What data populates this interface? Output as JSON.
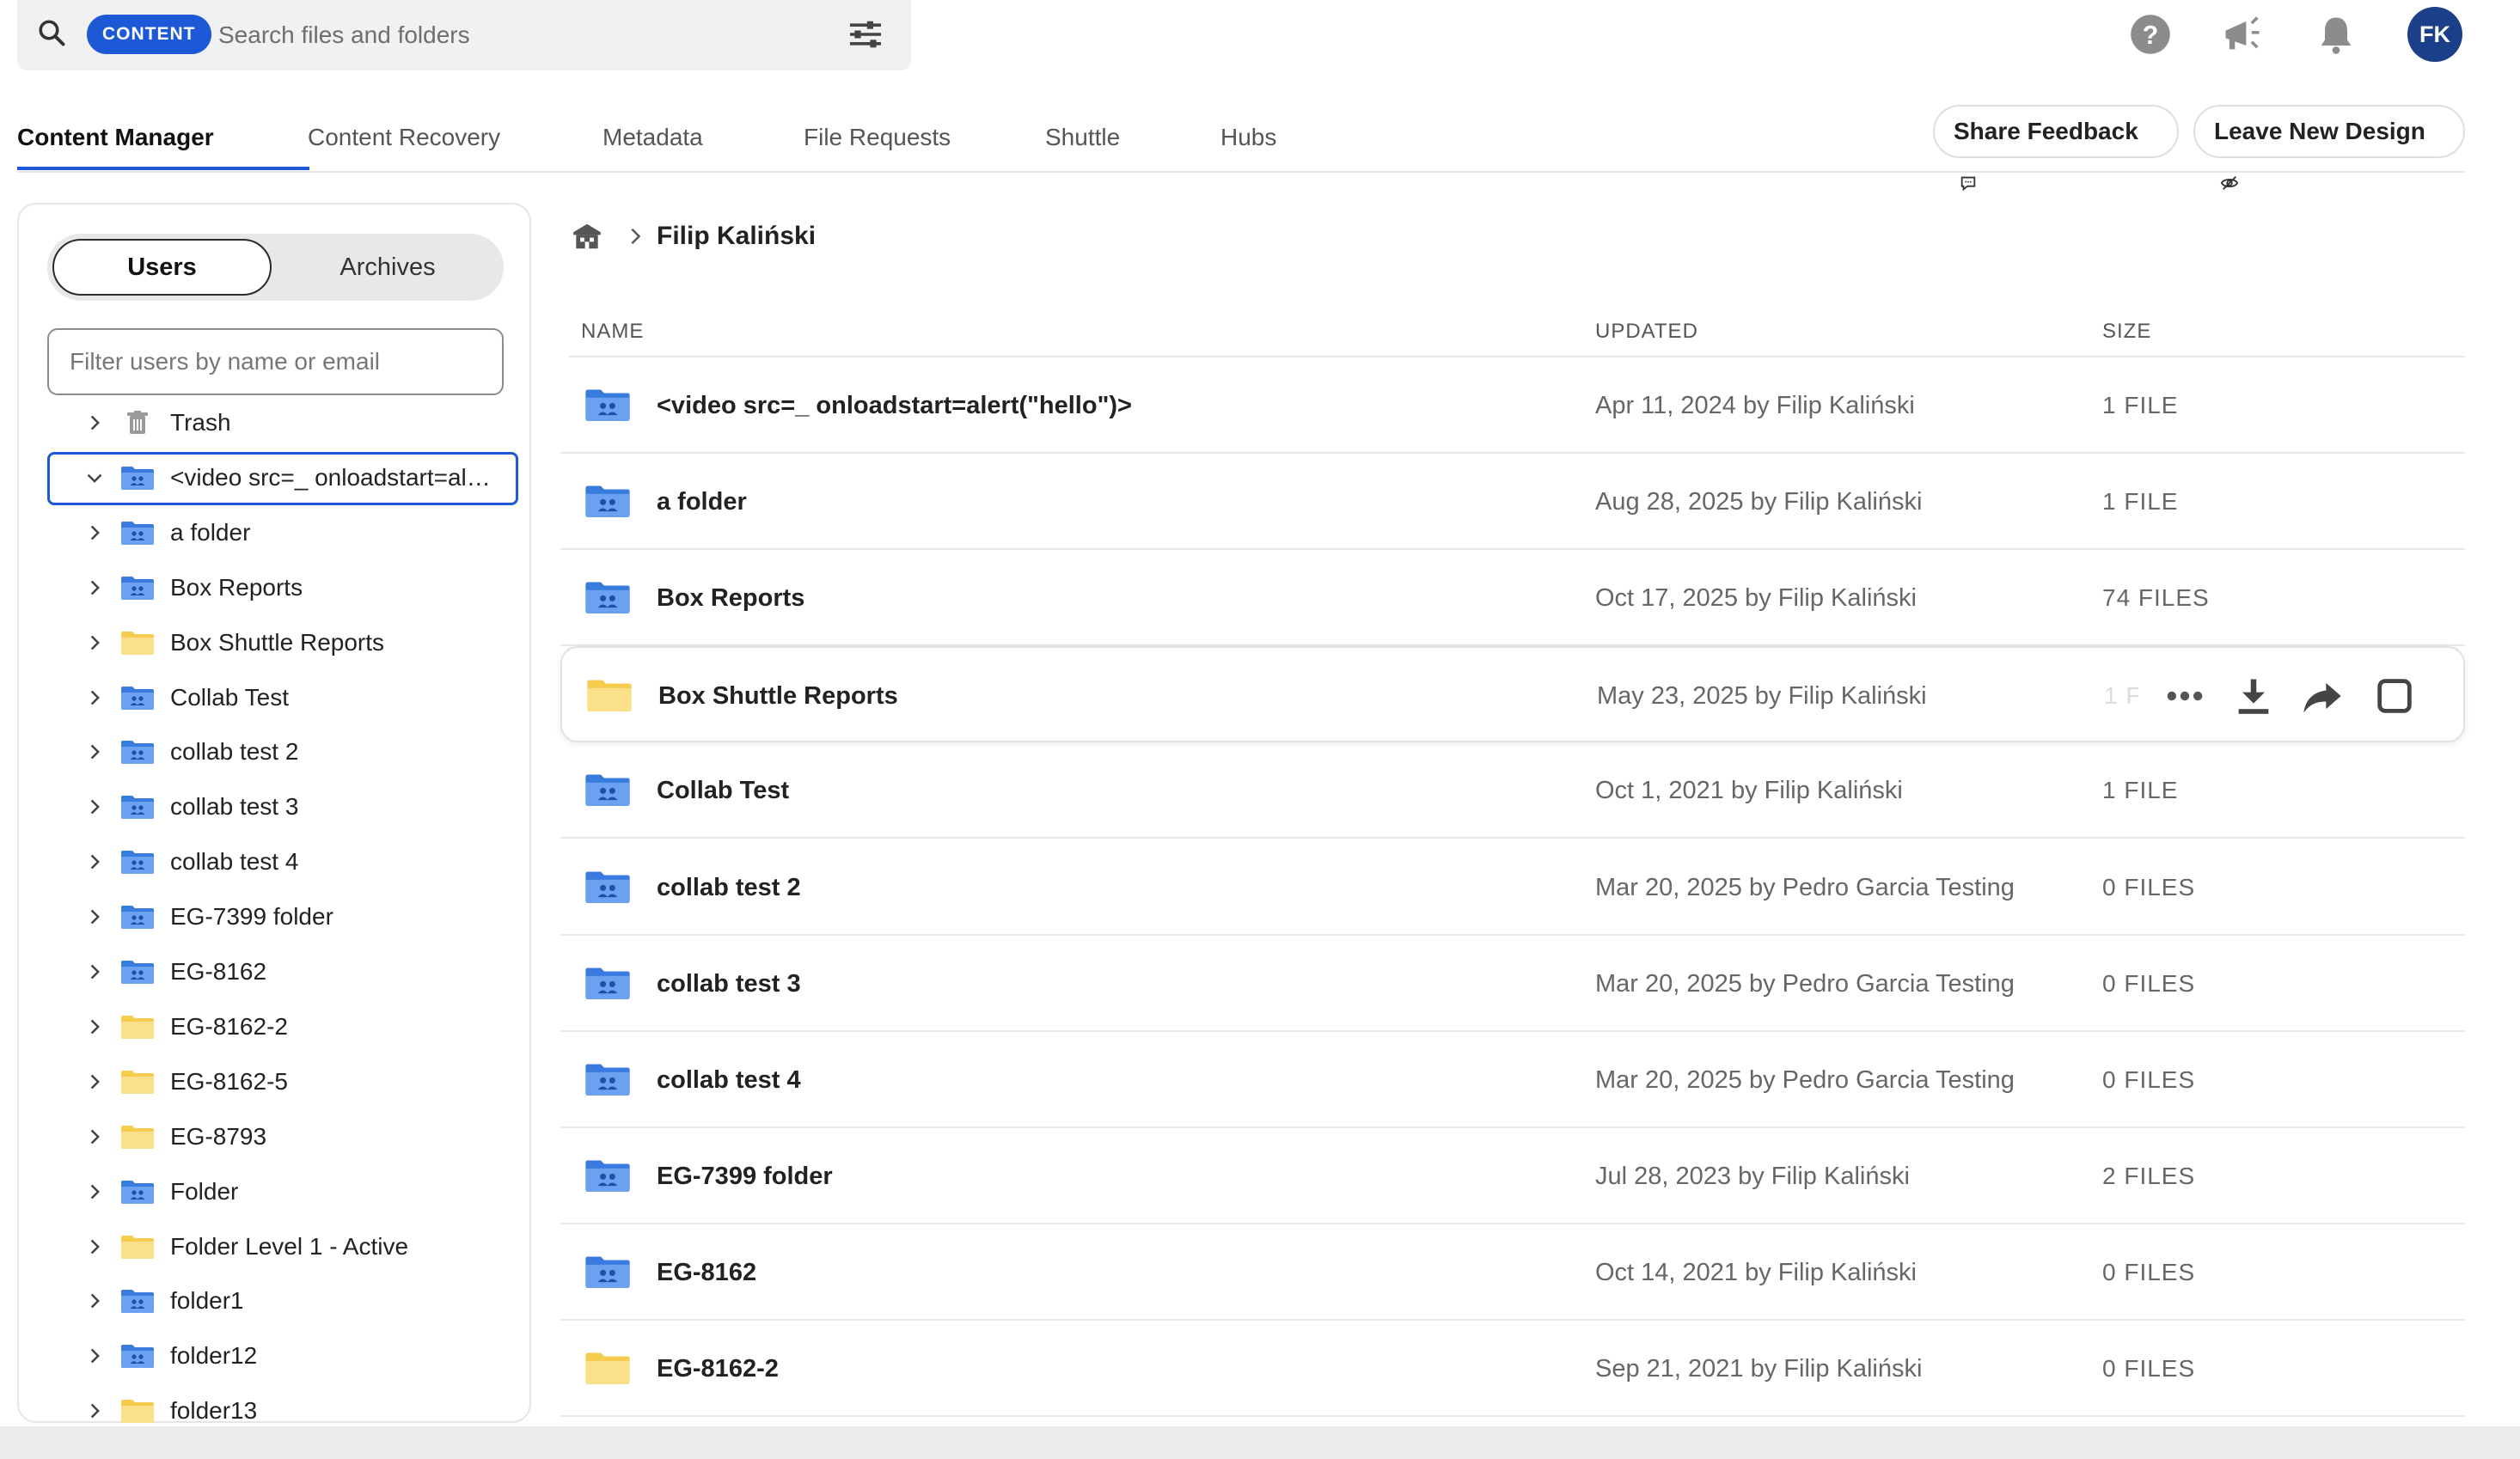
{
  "search": {
    "scope_label": "CONTENT",
    "placeholder": "Search files and folders"
  },
  "user": {
    "initials": "FK"
  },
  "tabs": [
    {
      "label": "Content Manager",
      "active": true
    },
    {
      "label": "Content Recovery"
    },
    {
      "label": "Metadata"
    },
    {
      "label": "File Requests"
    },
    {
      "label": "Shuttle"
    },
    {
      "label": "Hubs"
    }
  ],
  "header_buttons": {
    "share_feedback": "Share Feedback",
    "leave_design": "Leave New Design"
  },
  "sidebar": {
    "segments": {
      "users": "Users",
      "archives": "Archives"
    },
    "filter_placeholder": "Filter users by name or email",
    "tree": [
      {
        "label": "Trash",
        "icon": "trash-icon"
      },
      {
        "label": "<video src=_ onloadstart=alert(\"hello\")>",
        "icon": "shared-folder-icon",
        "expanded": true,
        "selected": true
      },
      {
        "label": "a folder",
        "icon": "shared-folder-icon"
      },
      {
        "label": "Box Reports",
        "icon": "shared-folder-icon"
      },
      {
        "label": "Box Shuttle Reports",
        "icon": "folder-icon"
      },
      {
        "label": "Collab Test",
        "icon": "shared-folder-icon"
      },
      {
        "label": "collab test 2",
        "icon": "shared-folder-icon"
      },
      {
        "label": "collab test 3",
        "icon": "shared-folder-icon"
      },
      {
        "label": "collab test 4",
        "icon": "shared-folder-icon"
      },
      {
        "label": "EG-7399 folder",
        "icon": "shared-folder-icon"
      },
      {
        "label": "EG-8162",
        "icon": "shared-folder-icon"
      },
      {
        "label": "EG-8162-2",
        "icon": "folder-icon"
      },
      {
        "label": "EG-8162-5",
        "icon": "folder-icon"
      },
      {
        "label": "EG-8793",
        "icon": "folder-icon"
      },
      {
        "label": "Folder",
        "icon": "shared-folder-icon"
      },
      {
        "label": "Folder Level 1 - Active",
        "icon": "folder-icon"
      },
      {
        "label": "folder1",
        "icon": "shared-folder-icon"
      },
      {
        "label": "folder12",
        "icon": "shared-folder-icon"
      },
      {
        "label": "folder13",
        "icon": "folder-icon"
      }
    ]
  },
  "breadcrumb": {
    "current": "Filip Kaliński"
  },
  "columns": {
    "name": "NAME",
    "updated": "UPDATED",
    "size": "SIZE"
  },
  "files": [
    {
      "name": "<video src=_ onloadstart=alert(\"hello\")>",
      "updated": "Apr 11, 2024 by Filip Kaliński",
      "size": "1 FILE",
      "icon": "shared-folder-icon"
    },
    {
      "name": "a folder",
      "updated": "Aug 28, 2025 by Filip Kaliński",
      "size": "1 FILE",
      "icon": "shared-folder-icon"
    },
    {
      "name": "Box Reports",
      "updated": "Oct 17, 2025 by Filip Kaliński",
      "size": "74 FILES",
      "icon": "shared-folder-icon"
    },
    {
      "name": "Box Shuttle Reports",
      "updated": "May 23, 2025 by Filip Kaliński",
      "size": "1 F",
      "icon": "folder-icon",
      "hovered": true
    },
    {
      "name": "Collab Test",
      "updated": "Oct 1, 2021 by Filip Kaliński",
      "size": "1 FILE",
      "icon": "shared-folder-icon"
    },
    {
      "name": "collab test 2",
      "updated": "Mar 20, 2025 by Pedro Garcia Testing",
      "size": "0 FILES",
      "icon": "shared-folder-icon"
    },
    {
      "name": "collab test 3",
      "updated": "Mar 20, 2025 by Pedro Garcia Testing",
      "size": "0 FILES",
      "icon": "shared-folder-icon"
    },
    {
      "name": "collab test 4",
      "updated": "Mar 20, 2025 by Pedro Garcia Testing",
      "size": "0 FILES",
      "icon": "shared-folder-icon"
    },
    {
      "name": "EG-7399 folder",
      "updated": "Jul 28, 2023 by Filip Kaliński",
      "size": "2 FILES",
      "icon": "shared-folder-icon"
    },
    {
      "name": "EG-8162",
      "updated": "Oct 14, 2021 by Filip Kaliński",
      "size": "0 FILES",
      "icon": "shared-folder-icon"
    },
    {
      "name": "EG-8162-2",
      "updated": "Sep 21, 2021 by Filip Kaliński",
      "size": "0 FILES",
      "icon": "folder-icon"
    }
  ],
  "colors": {
    "accent": "#1d59d6",
    "shared_folder": "#4a8be6",
    "personal_folder": "#f8d86a"
  }
}
